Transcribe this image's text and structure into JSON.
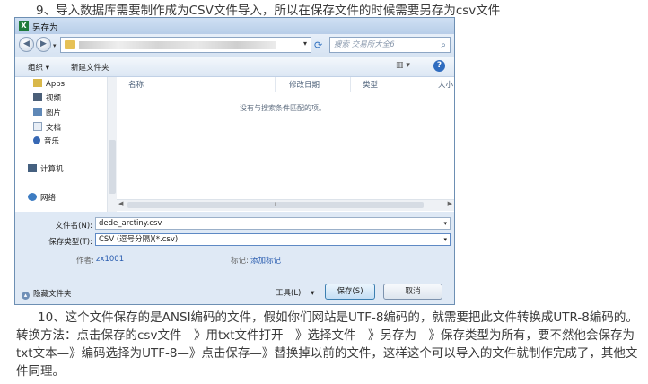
{
  "article": {
    "step9": "9、导入数据库需要制作成为CSV文件导入，所以在保存文件的时候需要另存为csv文件",
    "step10": "10、这个文件保存的是ANSI编码的文件，假如你们网站是UTF-8编码的，就需要把此文件转换成UTR-8编码的。转换方法：点击保存的csv文件—》用txt文件打开—》选择文件—》另存为—》保存类型为所有，要不然他会保存为txt文本—》编码选择为UTF-8—》点击保存—》替换掉以前的文件，这样这个可以导入的文件就制作完成了，其他文件同理。"
  },
  "dialog": {
    "title": "另存为",
    "search_placeholder": "搜索 交易所大全6",
    "toolbar": {
      "organize": "组织 ▾",
      "new_folder": "新建文件夹",
      "view": "▥ ▾",
      "help": "?"
    },
    "nav": [
      {
        "label": "Apps",
        "icon": "apps-icon"
      },
      {
        "label": "视频",
        "icon": "video-icon"
      },
      {
        "label": "图片",
        "icon": "picture-icon"
      },
      {
        "label": "文档",
        "icon": "document-icon"
      },
      {
        "label": "音乐",
        "icon": "music-icon"
      },
      {
        "label": "计算机",
        "icon": "computer-icon"
      },
      {
        "label": "网络",
        "icon": "network-icon"
      }
    ],
    "columns": [
      "名称",
      "修改日期",
      "类型",
      "大小"
    ],
    "empty_message": "没有与搜索条件匹配的项。",
    "filename_label": "文件名(N):",
    "filename_value": "dede_arctiny.csv",
    "filetype_label": "保存类型(T):",
    "filetype_value": "CSV (逗号分隔)(*.csv)",
    "author_label": "作者:",
    "author_value": "zx1001",
    "tags_label": "标记:",
    "tags_value": "添加标记",
    "hide_folders": "隐藏文件夹",
    "tools": "工具(L)",
    "save": "保存(S)",
    "cancel": "取消"
  },
  "colors": {
    "accent": "#2f6cbf",
    "title_bar": "#b7cde8",
    "link": "#2a5db0"
  }
}
